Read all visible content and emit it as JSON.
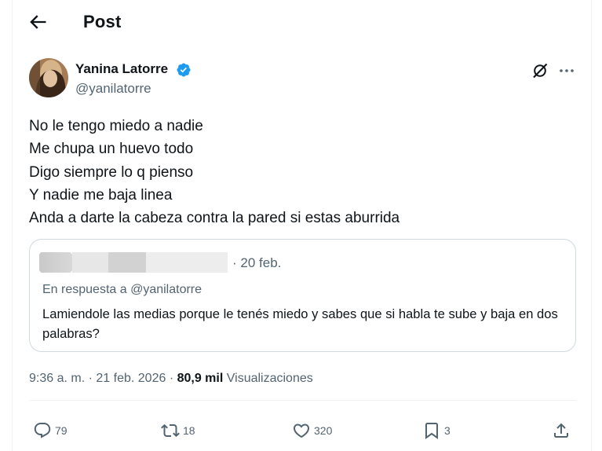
{
  "header": {
    "title": "Post"
  },
  "author": {
    "name": "Yanina Latorre",
    "handle": "@yanilatorre",
    "verified": true
  },
  "icons": {
    "back": "arrow-left-icon",
    "verified": "verified-badge-icon",
    "grok": "grok-icon",
    "more": "more-icon",
    "reply": "reply-icon",
    "retweet": "retweet-icon",
    "like": "heart-icon",
    "bookmark": "bookmark-icon",
    "share": "share-icon"
  },
  "tweet": {
    "lines": [
      "No le tengo miedo a nadie",
      "Me chupa un huevo todo",
      "Digo siempre lo q pienso",
      "Y nadie me baja linea",
      "Anda a darte la cabeza contra la pared si estas aburrida"
    ]
  },
  "quote": {
    "date": "· 20 feb.",
    "reply_to": "En respuesta a @yanilatorre",
    "text": "Lamiendole las medias porque le tenés miedo y sabes que si habla te sube y baja en dos palabras?"
  },
  "meta": {
    "time": "9:36 a. m.",
    "separator": "·",
    "date": "21 feb. 2026",
    "views_count": "80,9 mil",
    "views_label": "Visualizaciones"
  },
  "actions": {
    "replies": "79",
    "retweets": "18",
    "likes": "320",
    "bookmarks": "3"
  },
  "colors": {
    "text": "#0f1419",
    "secondary": "#536471",
    "verified": "#1d9bf0",
    "border": "#cfd9de"
  }
}
